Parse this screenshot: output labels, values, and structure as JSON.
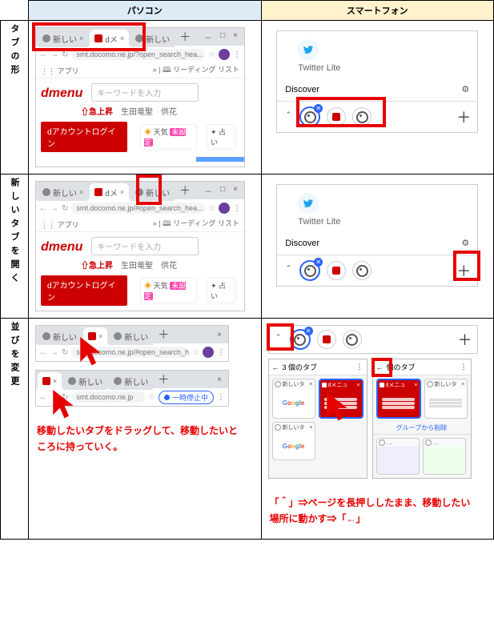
{
  "headers": {
    "pc": "パソコン",
    "sp": "スマートフォン"
  },
  "rows": {
    "shape": "タブの形",
    "newtab": "新しいタブを開く",
    "reorder": "並びを変更"
  },
  "browser": {
    "tab_new_short": "新しい",
    "tab_d_short": "dメ",
    "tab_new2_short": "新しい",
    "win_min": "－",
    "win_max": "□",
    "win_close": "×",
    "plus": "＋",
    "nav_back": "←",
    "nav_fwd": "→",
    "nav_reload": "↻",
    "url1": "smt.docomo.ne.jp/?open_search_hea...",
    "url_short": "smt.docomo.ne.jp/#open_search_hea...",
    "url_plain": "smt.docomo.ne.jp",
    "star": "☆",
    "apps": "アプリ",
    "readlist": "リーディング リスト",
    "menu": "⋮",
    "content": {
      "dmenu": "dmenu",
      "search_placeholder": "キーワードを入力",
      "rising_label": "急上昇",
      "person1": "生田竜聖",
      "person2": "供花",
      "daccount": "dアカウントログイン",
      "weather": "天気",
      "weather_badge": "未設定",
      "fortune": "占い"
    },
    "pause": "一時停止中"
  },
  "phone": {
    "twitter": "Twitter Lite",
    "discover": "Discover",
    "gear": "⚙",
    "chev_up": "＾",
    "plus": "＋",
    "tabcount1": "3 個のタブ",
    "tabcount2": "個のタブ",
    "back": "←",
    "card_new": "新しいタ",
    "card_dmenu": "dメニュ",
    "group_remove": "グループから削除"
  },
  "captions": {
    "drag_pc": "移動したいタブをドラッグして、移動したいところに持っていく。",
    "drag_sp": "「＾」⇒ページを長押ししたまま、移動したい場所に動かす⇒「←」"
  }
}
